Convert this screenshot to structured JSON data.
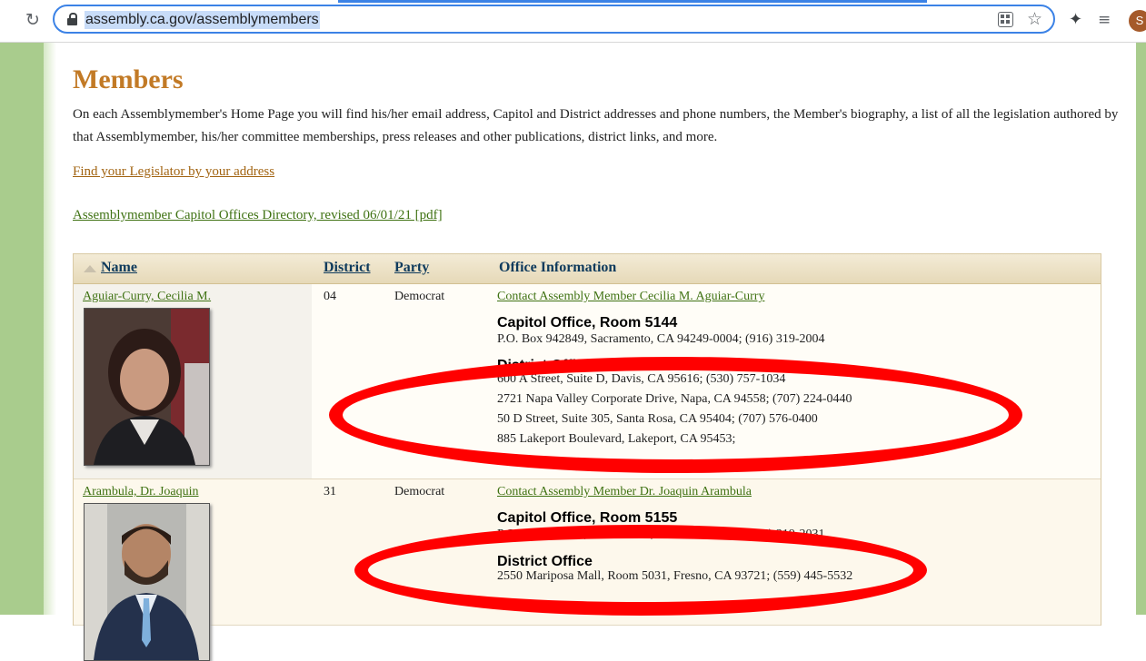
{
  "browser": {
    "reload_icon": "reload-icon",
    "url": "assembly.ca.gov/assemblymembers",
    "avatar_letter": "S"
  },
  "page": {
    "title": "Members",
    "intro": "On each Assemblymember's Home Page you will find his/her email address, Capitol and District addresses and phone numbers, the Member's biography, a list of all the legislation authored by that Assemblymember, his/her committee memberships, press releases and other publications, district links, and more.",
    "find_link": "Find your Legislator by your address",
    "directory_link": "Assemblymember Capitol Offices Directory, revised 06/01/21 [pdf]"
  },
  "table": {
    "headers": [
      "Name",
      "District",
      "Party",
      "Office Information"
    ],
    "rows": [
      {
        "name": "Aguiar-Curry, Cecilia M.",
        "district": "04",
        "party": "Democrat",
        "contact": "Contact Assembly Member Cecilia M. Aguiar-Curry",
        "capitol_heading": "Capitol Office, Room 5144",
        "capitol_address": "P.O. Box 942849, Sacramento, CA 94249-0004; (916) 319-2004",
        "district_heading": "District Office",
        "district_addresses": [
          "600 A Street, Suite D, Davis, CA 95616; (530) 757-1034",
          "2721 Napa Valley Corporate Drive, Napa, CA 94558; (707) 224-0440",
          "50 D Street, Suite 305, Santa Rosa, CA 95404; (707) 576-0400",
          "885 Lakeport Boulevard, Lakeport, CA 95453;"
        ]
      },
      {
        "name": "Arambula, Dr. Joaquin",
        "district": "31",
        "party": "Democrat",
        "contact": "Contact Assembly Member Dr. Joaquin Arambula",
        "capitol_heading": "Capitol Office, Room 5155",
        "capitol_address": "P.O. Box 942849, Sacramento, CA 94249-0031; (916) 319-2031",
        "district_heading": "District Office",
        "district_addresses": [
          "2550 Mariposa Mall, Room 5031, Fresno, CA 93721; (559) 445-5532"
        ]
      }
    ]
  },
  "colors": {
    "title": "#c27a26",
    "link_green": "#3f7213",
    "link_orange": "#a26412",
    "header_text": "#0e3a5c",
    "annotation_red": "#ff0000",
    "side_green": "#a9cc8d"
  }
}
